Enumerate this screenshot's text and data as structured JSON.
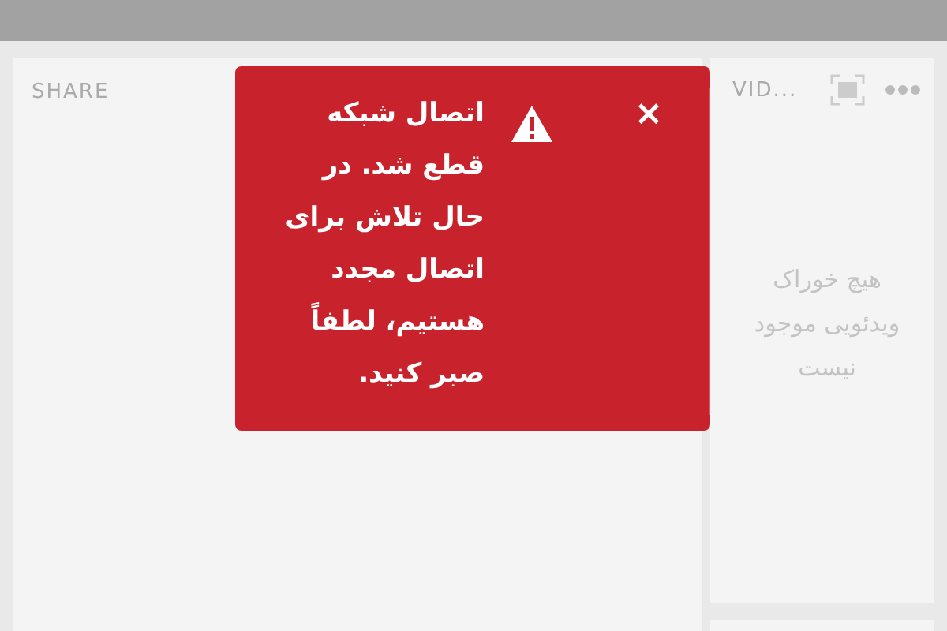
{
  "share_panel": {
    "title": "SHARE"
  },
  "video_panel": {
    "title": "VID...",
    "empty_message": "هیچ خوراک ویدئویی موجود نیست"
  },
  "toast": {
    "message": "اتصال شبکه قطع شد. در حال تلاش برای اتصال مجدد هستیم، لطفاً صبر کنید.",
    "close": "×"
  }
}
